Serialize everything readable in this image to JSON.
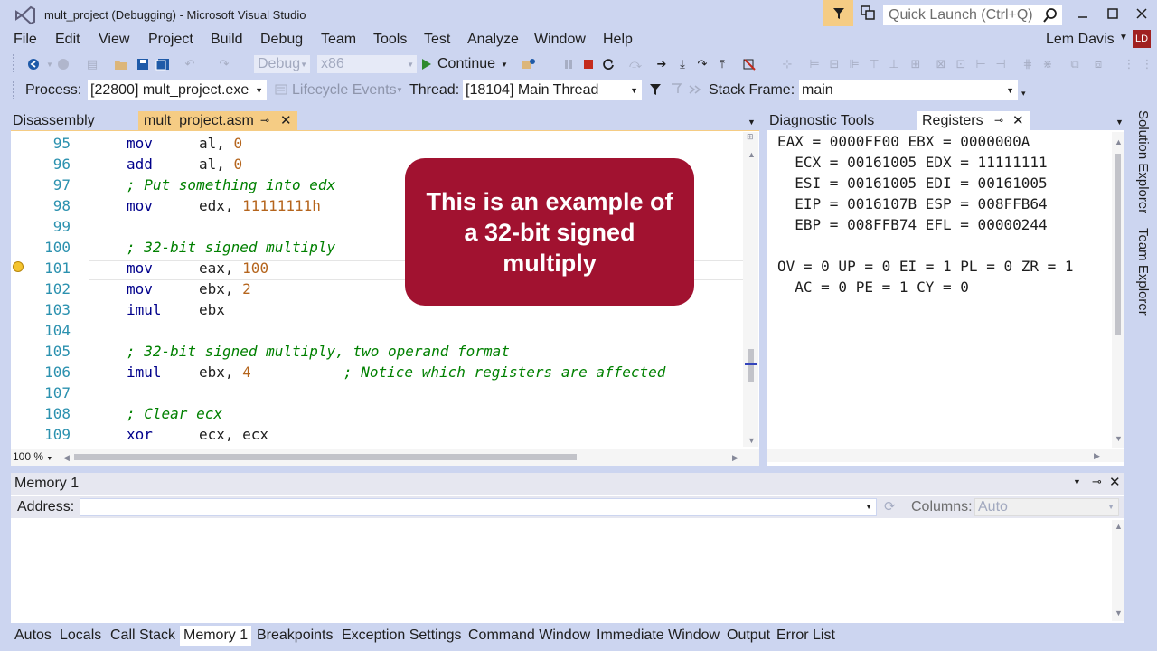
{
  "window": {
    "title": "mult_project (Debugging) - Microsoft Visual Studio",
    "quick_launch_placeholder": "Quick Launch (Ctrl+Q)",
    "user": "Lem Davis",
    "avatar_initials": "LD"
  },
  "menu": [
    "File",
    "Edit",
    "View",
    "Project",
    "Build",
    "Debug",
    "Team",
    "Tools",
    "Test",
    "Analyze",
    "Window",
    "Help"
  ],
  "toolbar": {
    "config": "Debug",
    "platform": "x86",
    "continue_label": "Continue"
  },
  "debug_location": {
    "process_label": "Process:",
    "process_value": "[22800] mult_project.exe",
    "lifecycle_label": "Lifecycle Events",
    "thread_label": "Thread:",
    "thread_value": "[18104] Main Thread",
    "stack_label": "Stack Frame:",
    "stack_value": "main"
  },
  "editor_tabs": {
    "disassembly": "Disassembly",
    "active": "mult_project.asm"
  },
  "code": [
    {
      "n": "95",
      "op": "mov",
      "args": "al, 0"
    },
    {
      "n": "96",
      "op": "add",
      "args": "al, 0"
    },
    {
      "n": "97",
      "comment": "; Put something into edx"
    },
    {
      "n": "98",
      "op": "mov",
      "args": "edx, 11111111h"
    },
    {
      "n": "99"
    },
    {
      "n": "100",
      "comment": "; 32-bit signed multiply"
    },
    {
      "n": "101",
      "op": "mov",
      "args": "eax, 100"
    },
    {
      "n": "102",
      "op": "mov",
      "args": "ebx, 2"
    },
    {
      "n": "103",
      "op": "imul",
      "args": "ebx"
    },
    {
      "n": "104"
    },
    {
      "n": "105",
      "comment": "; 32-bit signed multiply, two operand format"
    },
    {
      "n": "106",
      "op": "imul",
      "args": "ebx, 4",
      "trailing_comment": "; Notice which registers are affected"
    },
    {
      "n": "107"
    },
    {
      "n": "108",
      "comment": "; Clear ecx"
    },
    {
      "n": "109",
      "op": "xor",
      "args": "ecx, ecx"
    }
  ],
  "zoom": "100 %",
  "overlay": {
    "text": "This is an example of a 32-bit signed multiply",
    "color": "#A11230"
  },
  "tool_tabs": {
    "diagnostic": "Diagnostic Tools",
    "registers": "Registers"
  },
  "registers": [
    "EAX = 0000FF00 EBX = 0000000A",
    "  ECX = 00161005 EDX = 11111111",
    "  ESI = 00161005 EDI = 00161005",
    "  EIP = 0016107B ESP = 008FFB64",
    "  EBP = 008FFB74 EFL = 00000244",
    "",
    "OV = 0 UP = 0 EI = 1 PL = 0 ZR = 1",
    "  AC = 0 PE = 1 CY = 0"
  ],
  "side_panels": [
    "Solution Explorer",
    "Team Explorer"
  ],
  "memory": {
    "title": "Memory 1",
    "address_label": "Address:",
    "address_value": "",
    "columns_label": "Columns:",
    "columns_value": "Auto"
  },
  "bottom_tabs": [
    "Autos",
    "Locals",
    "Call Stack",
    "Memory 1",
    "Breakpoints",
    "Exception Settings",
    "Command Window",
    "Immediate Window",
    "Output",
    "Error List"
  ]
}
